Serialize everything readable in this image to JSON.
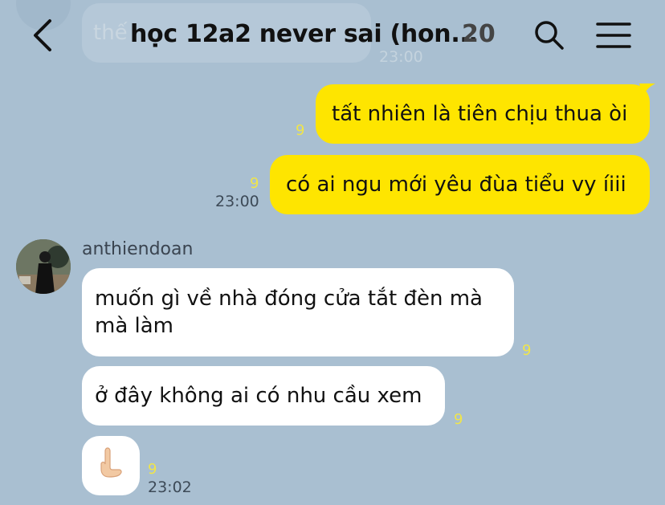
{
  "header": {
    "title": "học 12a2 never sai (hon...",
    "member_count": "20"
  },
  "background_message": {
    "text": "thế",
    "time": "23:00"
  },
  "messages": [
    {
      "from": "me",
      "text": "tất nhiên là tiên chịu thua òi",
      "unread": "9"
    },
    {
      "from": "me",
      "text": "có ai ngu mới yêu đùa tiểu vy íiii",
      "unread": "9",
      "time": "23:00"
    },
    {
      "from": "anthiendoan",
      "sender": "anthiendoan",
      "line1": "muốn gì về nhà đóng cửa tắt đèn mà",
      "line2": "mà làm",
      "unread": "9"
    },
    {
      "from": "anthiendoan",
      "text": "ở đây không ai có nhu cầu xem",
      "unread": "9"
    },
    {
      "from": "anthiendoan",
      "emoji": "👌",
      "unread": "9",
      "time": "23:02"
    }
  ],
  "colors": {
    "background": "#a9bfd1",
    "my_bubble": "#fee500",
    "their_bubble": "#ffffff",
    "unread": "#f0e54a"
  },
  "icons": [
    "back-arrow-icon",
    "search-icon",
    "menu-icon"
  ]
}
